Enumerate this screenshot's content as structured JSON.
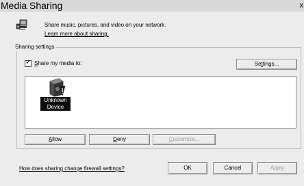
{
  "window": {
    "title": "Media Sharing",
    "close_glyph": "x"
  },
  "intro": {
    "icon": "media-sharing-icon",
    "text": "Share music, pictures, and video on your network.",
    "learn_more_link": "Learn more about sharing."
  },
  "sharing_settings": {
    "group_label": "Sharing settings",
    "share_media_checkbox": {
      "checked": true,
      "label_accesskey": "S",
      "label_rest": "hare my media to:"
    },
    "settings_button": {
      "accesskey": "t",
      "before": "Se",
      "after": "tings..."
    },
    "devices": [
      {
        "name_line1": "Unknown",
        "name_line2": "Device",
        "icon": "unknown-device-icon",
        "selected": true
      }
    ],
    "allow_button": {
      "accesskey": "A",
      "rest": "llow"
    },
    "deny_button": {
      "accesskey": "D",
      "rest": "eny"
    },
    "customize_button": {
      "accesskey": "C",
      "rest": "ustomize...",
      "disabled": true
    }
  },
  "footer": {
    "firewall_link": "How does sharing change firewall settings?",
    "ok_label": "OK",
    "cancel_label": "Cancel",
    "apply_label": "Apply",
    "apply_disabled": true
  }
}
